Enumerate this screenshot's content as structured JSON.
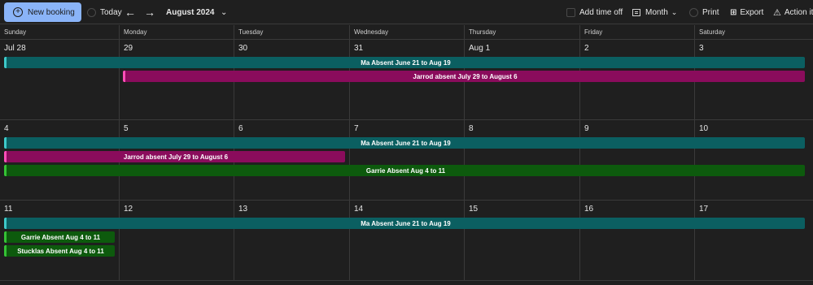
{
  "toolbar": {
    "new_booking": "New booking",
    "today": "Today",
    "prev_icon": "arrow-left-icon",
    "next_icon": "arrow-right-icon",
    "period": "August 2024",
    "add_time_off": "Add time off",
    "view": "Month",
    "print": "Print",
    "export": "Export",
    "action": "Action it"
  },
  "weekdays": [
    "Sunday",
    "Monday",
    "Tuesday",
    "Wednesday",
    "Thursday",
    "Friday",
    "Saturday"
  ],
  "weeks": [
    {
      "dates": [
        "Jul 28",
        "29",
        "30",
        "31",
        "Aug 1",
        "2",
        "3"
      ],
      "events": [
        {
          "label": "Ma Absent June 21 to Aug 19",
          "start": 0,
          "span": 7,
          "row": 0,
          "color": "#0b5f61",
          "accent": "#3ec9c9"
        },
        {
          "label": "Jarrod absent July 29 to August 6",
          "start": 1,
          "span": 6,
          "row": 1,
          "color": "#8a0c5c",
          "accent": "#ff4fb8"
        }
      ]
    },
    {
      "dates": [
        "4",
        "5",
        "6",
        "7",
        "8",
        "9",
        "10"
      ],
      "events": [
        {
          "label": "Ma Absent June 21 to Aug 19",
          "start": 0,
          "span": 7,
          "row": 0,
          "color": "#0b5f61",
          "accent": "#3ec9c9"
        },
        {
          "label": "Jarrod absent July 29 to August 6",
          "start": 0,
          "span": 3,
          "row": 1,
          "color": "#8a0c5c",
          "accent": "#ff4fb8"
        },
        {
          "label": "Garrie Absent Aug 4 to 11",
          "start": 0,
          "span": 7,
          "row": 2,
          "color": "#0d5a0d",
          "accent": "#35c235"
        }
      ]
    },
    {
      "dates": [
        "11",
        "12",
        "13",
        "14",
        "15",
        "16",
        "17"
      ],
      "events": [
        {
          "label": "Ma Absent June 21 to Aug 19",
          "start": 0,
          "span": 7,
          "row": 0,
          "color": "#0b5f61",
          "accent": "#3ec9c9"
        },
        {
          "label": "Garrie Absent Aug 4 to 11",
          "start": 0,
          "span": 1,
          "row": 1,
          "color": "#0d5a0d",
          "accent": "#35c235"
        },
        {
          "label": "Stucklas Absent Aug 4 to 11",
          "start": 0,
          "span": 1,
          "row": 2,
          "color": "#0d5a0d",
          "accent": "#35c235"
        }
      ]
    }
  ]
}
